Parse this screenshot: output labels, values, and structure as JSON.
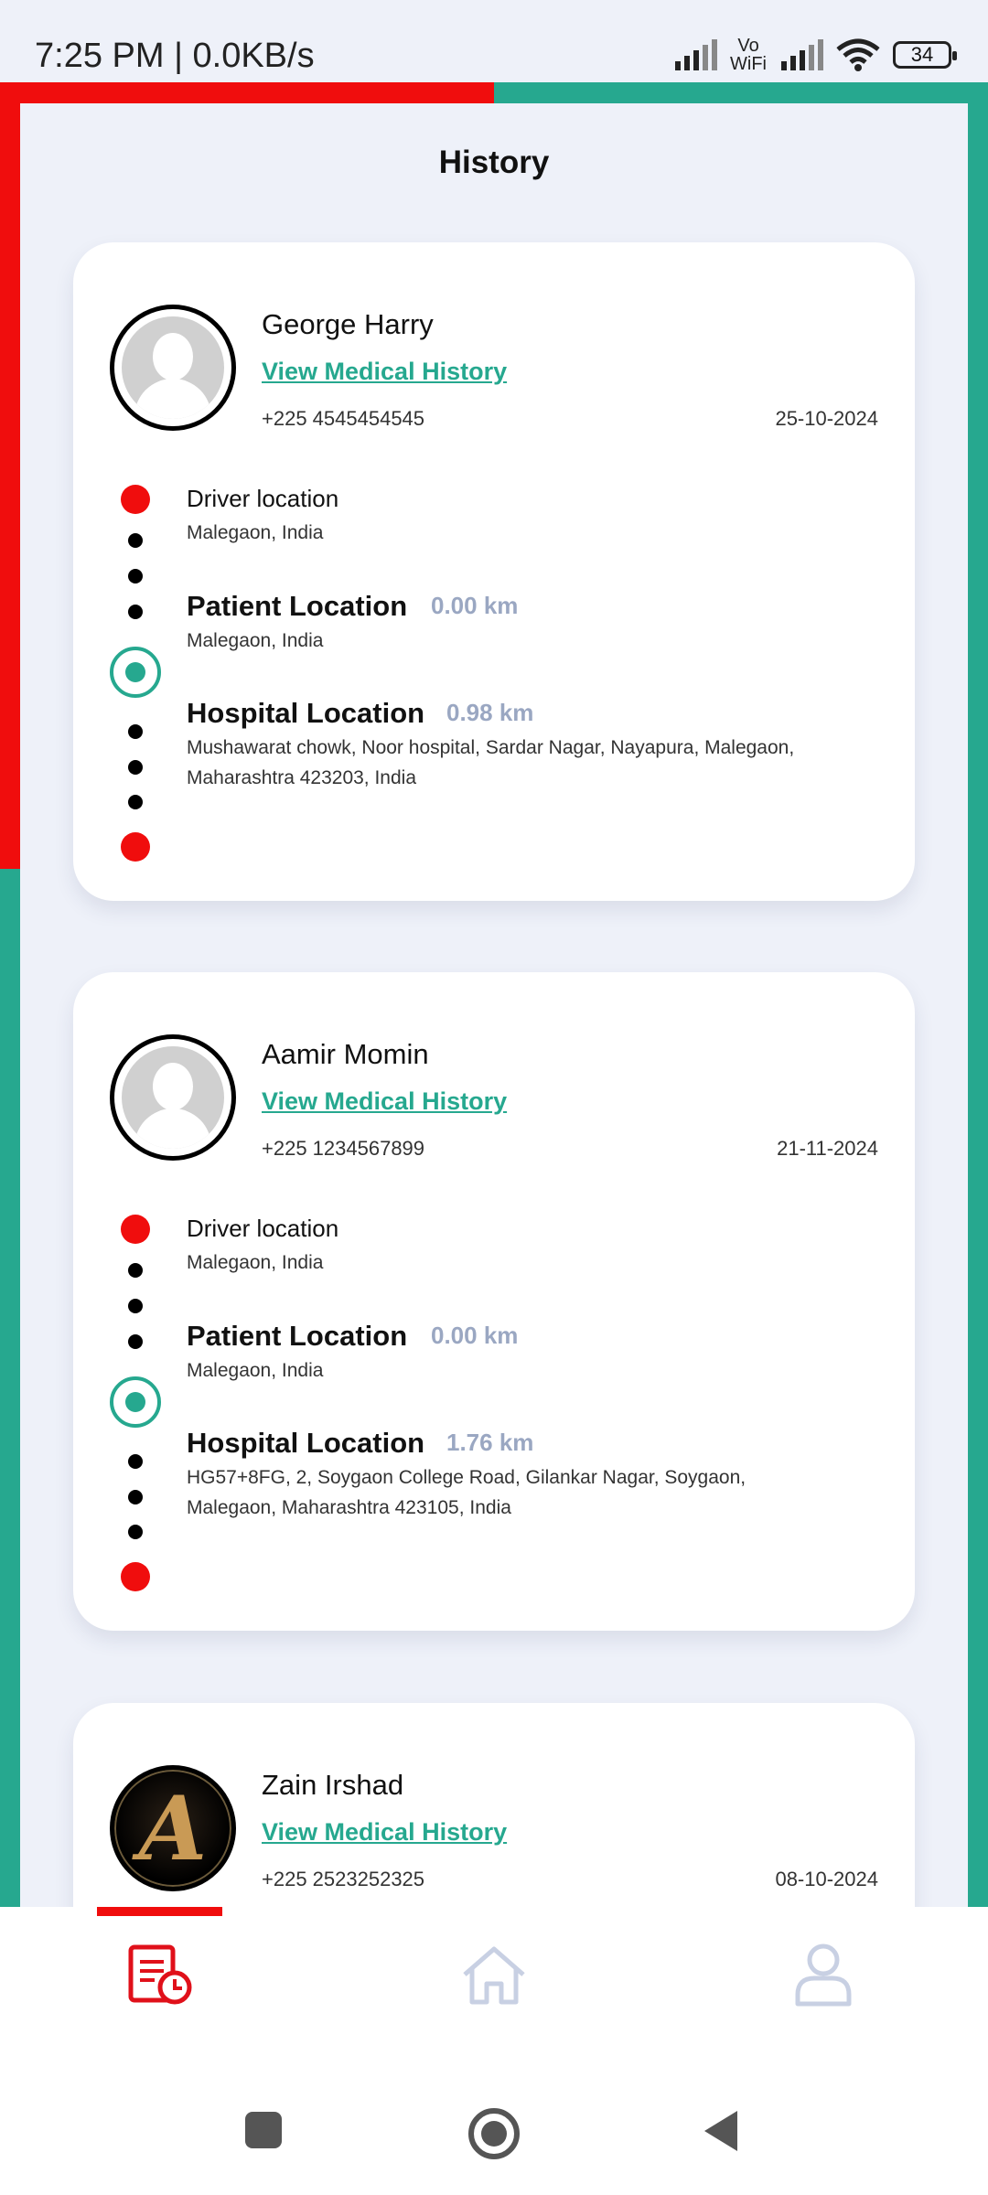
{
  "status_bar": {
    "time": "7:25 PM | 0.0KB/s",
    "vowifi_top": "Vo",
    "vowifi_bottom": "WiFi",
    "battery": "34"
  },
  "page": {
    "title": "History"
  },
  "colors": {
    "accent_red": "#f00d0d",
    "accent_green": "#26a88f",
    "muted_km": "#9aa7c2"
  },
  "history": [
    {
      "name": "George Harry",
      "link": "View Medical History",
      "phone": "+225 4545454545",
      "date": "25-10-2024",
      "driver_label": "Driver location",
      "driver_addr": "Malegaon, India",
      "patient_label": "Patient Location",
      "patient_km": "0.00 km",
      "patient_addr": "Malegaon, India",
      "hospital_label": "Hospital Location",
      "hospital_km": "0.98 km",
      "hospital_addr": "Mushawarat chowk, Noor hospital, Sardar Nagar, Nayapura, Malegaon, Maharashtra 423203, India"
    },
    {
      "name": "Aamir Momin",
      "link": "View Medical History",
      "phone": "+225 1234567899",
      "date": "21-11-2024",
      "driver_label": "Driver location",
      "driver_addr": "Malegaon, India",
      "patient_label": "Patient Location",
      "patient_km": "0.00 km",
      "patient_addr": "Malegaon, India",
      "hospital_label": "Hospital Location",
      "hospital_km": "1.76 km",
      "hospital_addr": "HG57+8FG, 2, Soygaon College Road, Gilankar Nagar, Soygaon, Malegaon, Maharashtra 423105, India"
    },
    {
      "name": "Zain Irshad",
      "link": "View Medical History",
      "phone": "+225 2523252325",
      "date": "08-10-2024",
      "avatar_letter": "A"
    }
  ],
  "bottom_nav": {
    "items": [
      {
        "icon": "history-icon",
        "active": true
      },
      {
        "icon": "home-icon",
        "active": false
      },
      {
        "icon": "profile-icon",
        "active": false
      }
    ]
  },
  "system_nav": {
    "icons": [
      "recents-icon",
      "home-circle-icon",
      "back-icon"
    ]
  }
}
